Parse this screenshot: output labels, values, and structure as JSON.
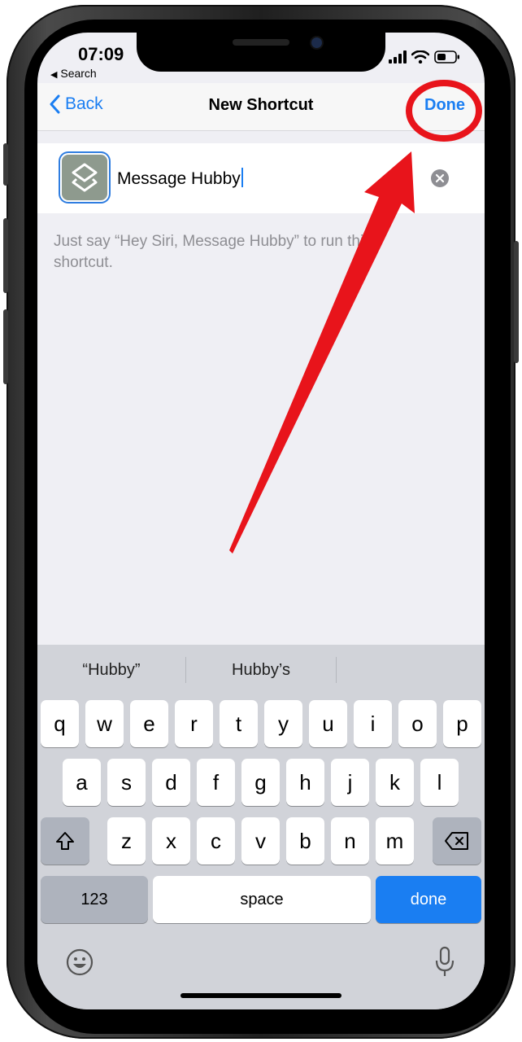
{
  "status": {
    "time": "07:09",
    "back_app": "Search"
  },
  "nav": {
    "back_label": "Back",
    "title": "New Shortcut",
    "done_label": "Done"
  },
  "shortcut": {
    "name_value": "Message Hubby",
    "hint": "Just say “Hey Siri, Message Hubby” to run this shortcut."
  },
  "keyboard": {
    "suggestions": [
      "“Hubby”",
      "Hubby’s",
      ""
    ],
    "row1": [
      "q",
      "w",
      "e",
      "r",
      "t",
      "y",
      "u",
      "i",
      "o",
      "p"
    ],
    "row2": [
      "a",
      "s",
      "d",
      "f",
      "g",
      "h",
      "j",
      "k",
      "l"
    ],
    "row3": [
      "z",
      "x",
      "c",
      "v",
      "b",
      "n",
      "m"
    ],
    "numbers_label": "123",
    "space_label": "space",
    "return_label": "done"
  },
  "colors": {
    "accent": "#1a7ef2",
    "annotation": "#e8141b"
  },
  "icons": [
    "chevron-left-icon",
    "signal-icon",
    "wifi-icon",
    "battery-icon",
    "shortcuts-icon",
    "clear-icon",
    "shift-icon",
    "delete-icon",
    "emoji-icon",
    "microphone-icon"
  ]
}
